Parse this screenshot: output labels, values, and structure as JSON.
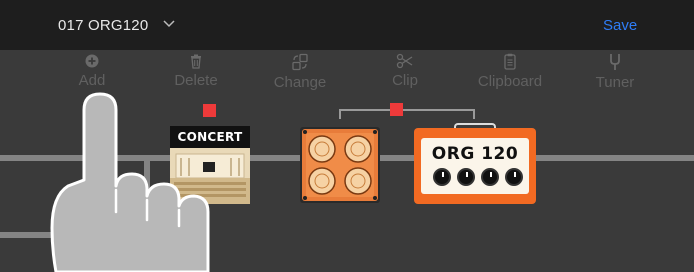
{
  "header": {
    "preset_name": "017 ORG120",
    "save_label": "Save"
  },
  "toolbar": {
    "items": [
      {
        "label": "Add",
        "icon": "plus-circle-icon"
      },
      {
        "label": "Delete",
        "icon": "trash-icon"
      },
      {
        "label": "Change",
        "icon": "swap-icon"
      },
      {
        "label": "Clip",
        "icon": "scissors-icon"
      },
      {
        "label": "Clipboard",
        "icon": "clipboard-icon"
      },
      {
        "label": "Tuner",
        "icon": "tuning-fork-icon"
      }
    ]
  },
  "signal_chain": {
    "blocks": [
      {
        "name": "CONCERT HALL",
        "type": "reverb"
      },
      {
        "name": "",
        "type": "cabinet"
      },
      {
        "name": "ORG 120",
        "type": "amp"
      }
    ]
  },
  "colors": {
    "accent": "#2f7df6",
    "select_marker": "#ee3a3a",
    "amp_orange": "#f26a22"
  }
}
